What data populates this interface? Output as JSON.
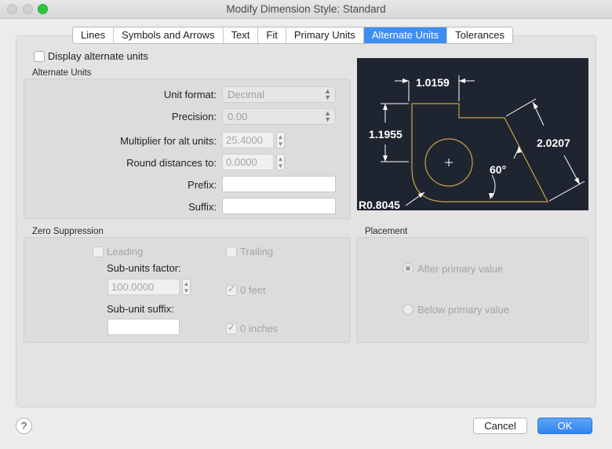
{
  "window": {
    "title": "Modify Dimension Style: Standard"
  },
  "tabs": [
    {
      "label": "Lines",
      "active": false
    },
    {
      "label": "Symbols and Arrows",
      "active": false
    },
    {
      "label": "Text",
      "active": false
    },
    {
      "label": "Fit",
      "active": false
    },
    {
      "label": "Primary Units",
      "active": false
    },
    {
      "label": "Alternate Units",
      "active": true
    },
    {
      "label": "Tolerances",
      "active": false
    }
  ],
  "display_alternate_units": {
    "label": "Display alternate units",
    "checked": false
  },
  "alternate_units": {
    "section_title": "Alternate Units",
    "unit_format": {
      "label": "Unit format:",
      "value": "Decimal"
    },
    "precision": {
      "label": "Precision:",
      "value": "0.00"
    },
    "multiplier": {
      "label": "Multiplier for alt units:",
      "value": "25.4000"
    },
    "round_distances": {
      "label": "Round distances to:",
      "value": "0.0000"
    },
    "prefix": {
      "label": "Prefix:",
      "value": ""
    },
    "suffix": {
      "label": "Suffix:",
      "value": ""
    }
  },
  "zero_suppression": {
    "section_title": "Zero Suppression",
    "leading": {
      "label": "Leading",
      "checked": false
    },
    "trailing": {
      "label": "Trailing",
      "checked": false
    },
    "sub_units_factor": {
      "label": "Sub-units factor:",
      "value": "100.0000"
    },
    "sub_unit_suffix": {
      "label": "Sub-unit suffix:",
      "value": ""
    },
    "zero_feet": {
      "label": "0 feet",
      "checked": true
    },
    "zero_inches": {
      "label": "0 inches",
      "checked": true
    }
  },
  "placement": {
    "section_title": "Placement",
    "after_primary": {
      "label": "After primary value",
      "selected": true
    },
    "below_primary": {
      "label": "Below primary value",
      "selected": false
    }
  },
  "preview": {
    "dim_top": "1.0159",
    "dim_left": "1.1955",
    "dim_diag": "2.0207",
    "angle": "60°",
    "radius": "R0.8045",
    "colors": {
      "background": "#1f2530",
      "geometry": "#c8a24a",
      "dimension": "#ffffff"
    }
  },
  "buttons": {
    "help": "?",
    "cancel": "Cancel",
    "ok": "OK"
  },
  "colors": {
    "accent": "#3d8ef3"
  }
}
